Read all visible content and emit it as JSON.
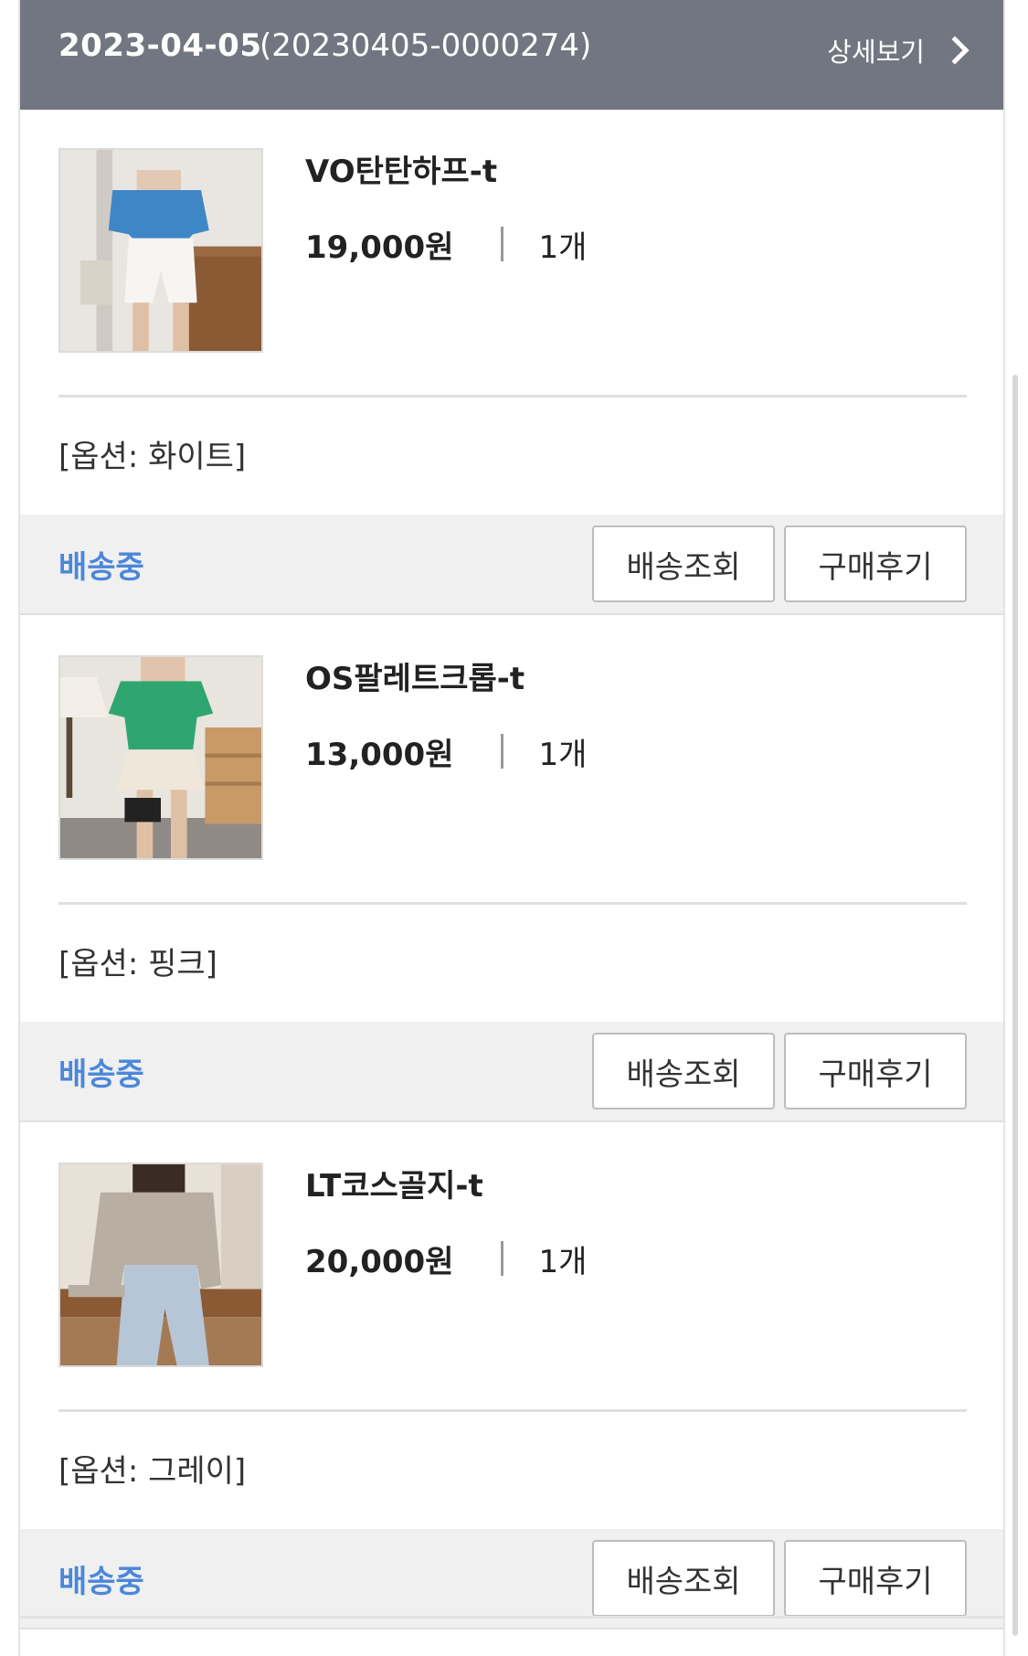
{
  "order": {
    "date": "2023-04-05",
    "number": "(20230405-0000274)",
    "detail_label": "상세보기"
  },
  "items": [
    {
      "name": "VO탄탄하프-t",
      "price": "19,000원",
      "qty": "1개",
      "option": "[옵션: 화이트]",
      "status": "배송중",
      "track_label": "배송조회",
      "review_label": "구매후기"
    },
    {
      "name": "OS팔레트크롭-t",
      "price": "13,000원",
      "qty": "1개",
      "option": "[옵션: 핑크]",
      "status": "배송중",
      "track_label": "배송조회",
      "review_label": "구매후기"
    },
    {
      "name": "LT코스골지-t",
      "price": "20,000원",
      "qty": "1개",
      "option": "[옵션: 그레이]",
      "status": "배송중",
      "track_label": "배송조회",
      "review_label": "구매후기"
    }
  ],
  "colors": {
    "header_bg": "#727680",
    "status_text": "#4b87d9",
    "status_bar_bg": "#f0f0f0"
  }
}
